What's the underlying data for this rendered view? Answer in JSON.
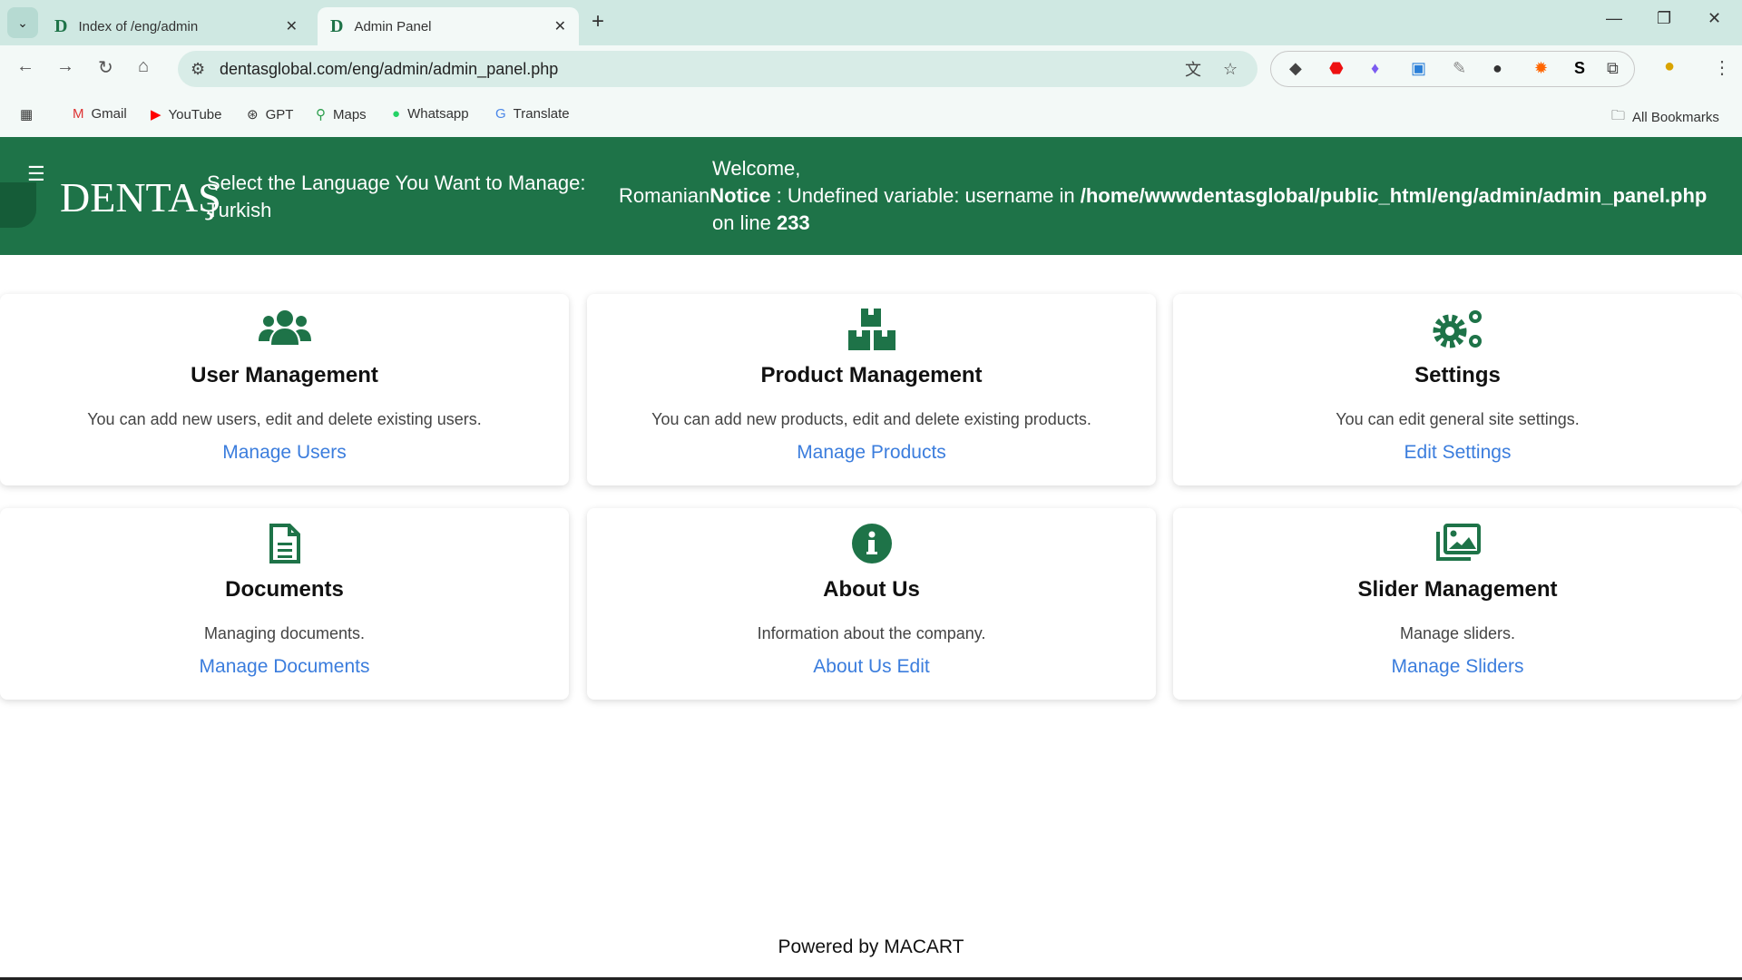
{
  "browser": {
    "tabs": [
      {
        "title": "Index of /eng/admin",
        "active": false
      },
      {
        "title": "Admin Panel",
        "active": true
      }
    ],
    "url": "dentasglobal.com/eng/admin/admin_panel.php",
    "bookmarks": [
      "Gmail",
      "YouTube",
      "GPT",
      "Maps",
      "Whatsapp",
      "Translate"
    ],
    "all_bookmarks": "All Bookmarks"
  },
  "header": {
    "logo": "DENTAŞ",
    "language_prompt": "Select the Language You Want to Manage:",
    "language_value": "Turkish",
    "welcome": "Welcome,",
    "welcome_lang": "Romanian",
    "notice_label": "Notice",
    "notice_text": " : Undefined variable: username in ",
    "notice_path": "/home/wwwdentasglobal/public_html/eng/admin/admin_panel.php",
    "line_label": "on line ",
    "line_number": "233"
  },
  "cards": [
    {
      "title": "User Management",
      "description": "You can add new users, edit and delete existing users.",
      "link": "Manage Users",
      "icon": "users-icon"
    },
    {
      "title": "Product Management",
      "description": "You can add new products, edit and delete existing products.",
      "link": "Manage Products",
      "icon": "boxes-icon"
    },
    {
      "title": "Settings",
      "description": "You can edit general site settings.",
      "link": "Edit Settings",
      "icon": "gears-icon"
    },
    {
      "title": "Documents",
      "description": "Managing documents.",
      "link": "Manage Documents",
      "icon": "document-icon"
    },
    {
      "title": "About Us",
      "description": "Information about the company.",
      "link": "About Us Edit",
      "icon": "info-icon"
    },
    {
      "title": "Slider Management",
      "description": "Manage sliders.",
      "link": "Manage Sliders",
      "icon": "images-icon"
    }
  ],
  "footer": "Powered by MACART",
  "colors": {
    "brand": "#1e7348",
    "link": "#3b7ddd"
  }
}
